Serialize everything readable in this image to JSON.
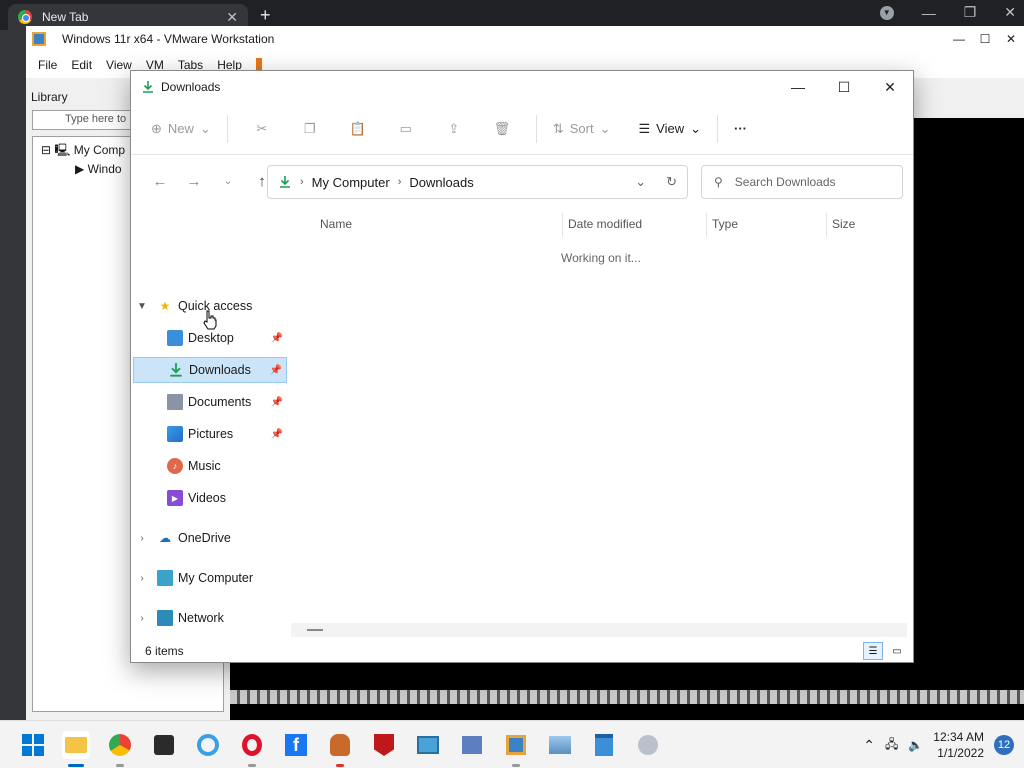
{
  "browser": {
    "tab_title": "New Tab",
    "tab_close": "✕",
    "new_tab": "+"
  },
  "vmware": {
    "title": "Windows 11r x64 - VMware Workstation",
    "menu": [
      "File",
      "Edit",
      "View",
      "VM",
      "Tabs",
      "Help"
    ],
    "library_title": "Library",
    "library_search_placeholder": "Type here to",
    "tree_root": "My Comp",
    "tree_child": "Windo"
  },
  "explorer": {
    "title": "Downloads",
    "toolbar": {
      "new_label": "New",
      "sort_label": "Sort",
      "view_label": "View",
      "more_label": "···"
    },
    "breadcrumb": [
      "My Computer",
      "Downloads"
    ],
    "search_placeholder": "Search Downloads",
    "nav": {
      "quick_access": "Quick access",
      "desktop": "Desktop",
      "downloads": "Downloads",
      "documents": "Documents",
      "pictures": "Pictures",
      "music": "Music",
      "videos": "Videos",
      "onedrive": "OneDrive",
      "my_computer": "My Computer",
      "network": "Network"
    },
    "columns": [
      "Name",
      "Date modified",
      "Type",
      "Size"
    ],
    "working_text": "Working on it...",
    "status_items": "6 items"
  },
  "taskbar": {
    "time": "12:34 AM",
    "date": "1/1/2022",
    "notification_count": "12"
  },
  "colors": {
    "accent": "#0067c0",
    "selection": "#cce4f7",
    "download_green": "#1f9d55"
  }
}
